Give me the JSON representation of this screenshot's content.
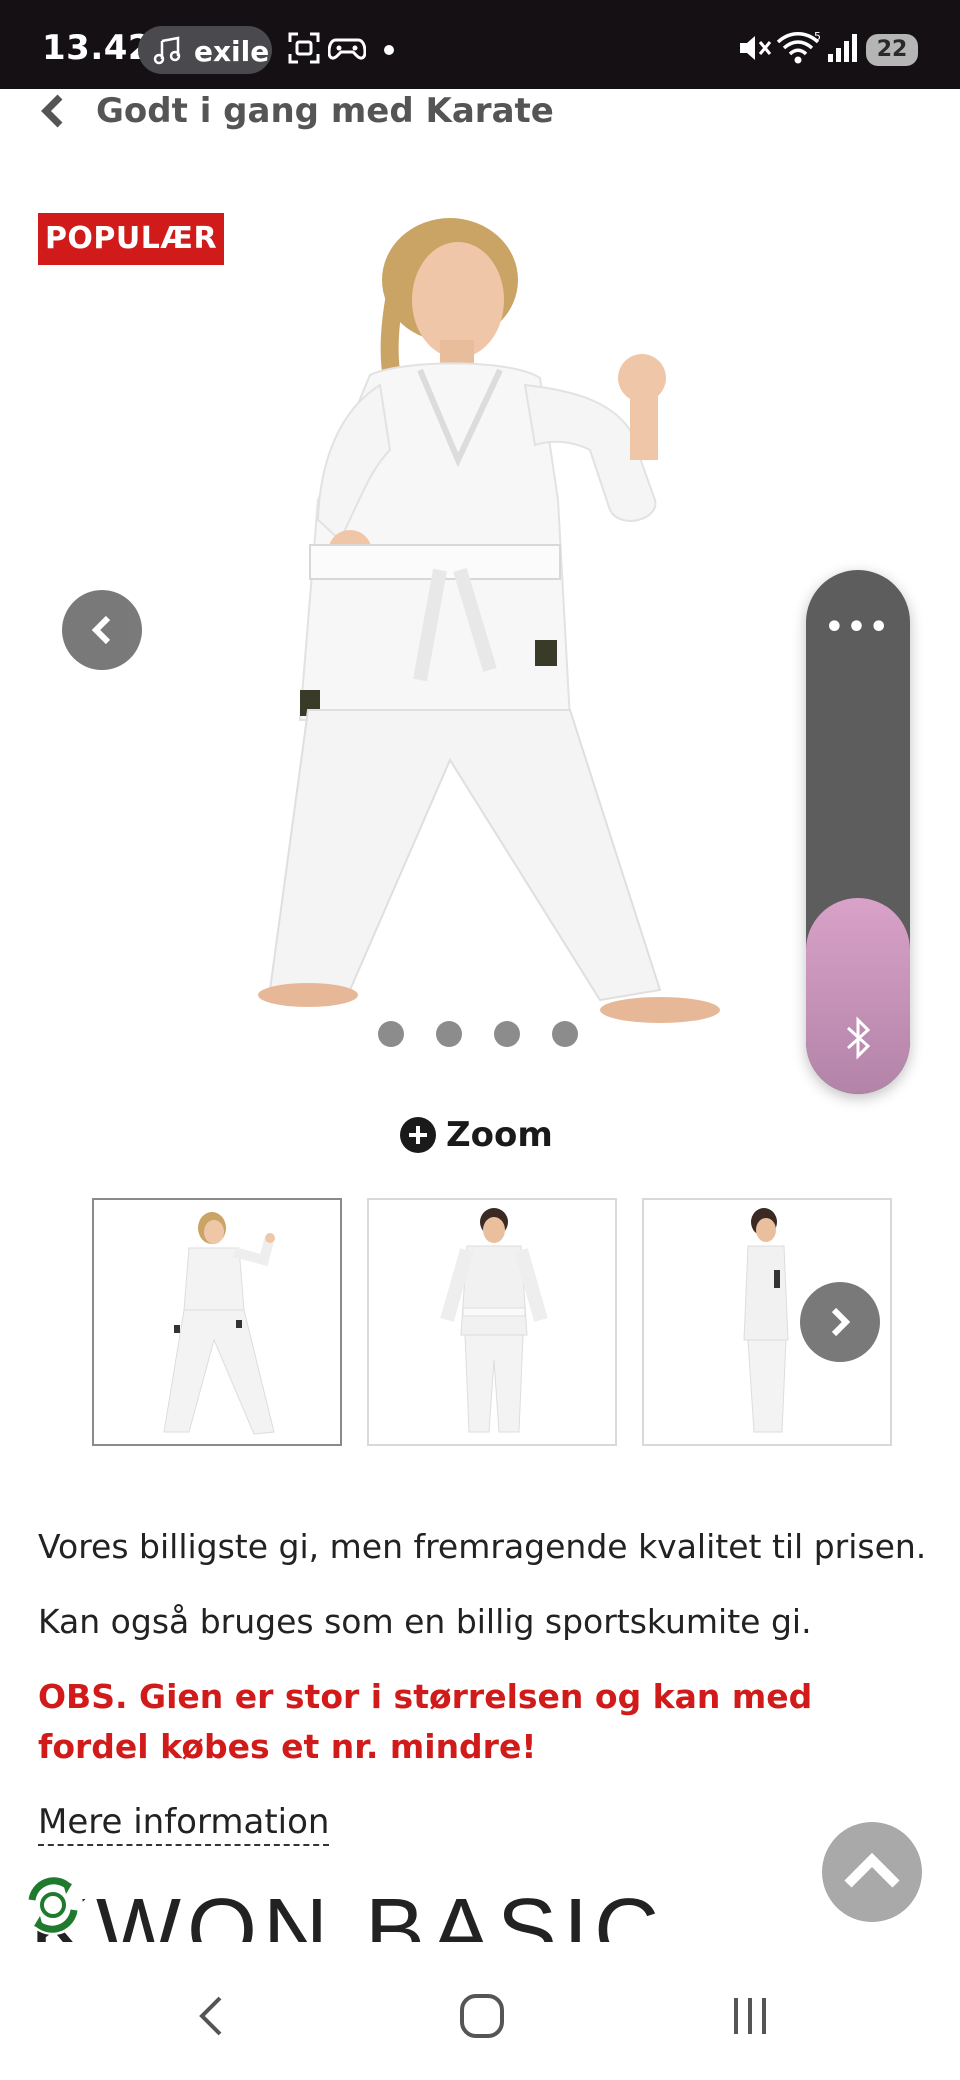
{
  "status_bar": {
    "time": "13.42",
    "media_label": "exile",
    "battery": "22",
    "icons": [
      "music-note-icon",
      "screen-capture-icon",
      "game-controller-icon",
      "dot-icon",
      "mute-icon",
      "wifi-icon",
      "signal-icon",
      "battery-icon"
    ]
  },
  "breadcrumb": {
    "icon": "chevron-left-icon",
    "label": "Godt i gang med Karate"
  },
  "product": {
    "badge": "POPULÆR",
    "carousel": {
      "total_slides": 4,
      "active_slide": 1
    },
    "zoom_label": "Zoom",
    "thumbnails": [
      {
        "name": "front-pose",
        "active": true
      },
      {
        "name": "front-standing",
        "active": false
      },
      {
        "name": "side-standing",
        "active": false
      }
    ],
    "description": [
      "Vores billigste gi, men fremragende kvalitet til prisen.",
      "Kan også bruges som en billig sportskumite gi."
    ],
    "warning": "OBS. Gien er stor i størrelsen og kan med fordel købes et nr. mindre!",
    "more_info": "Mere information",
    "title_partial": "KWON BASIC"
  },
  "side_panel": {
    "more_label": "•••",
    "icon": "bluetooth-icon"
  },
  "colors": {
    "accent_red": "#d11b1b",
    "status_bar_bg": "#141014",
    "panel_gray": "#5d5d5d",
    "panel_pink": "#c994bb"
  }
}
